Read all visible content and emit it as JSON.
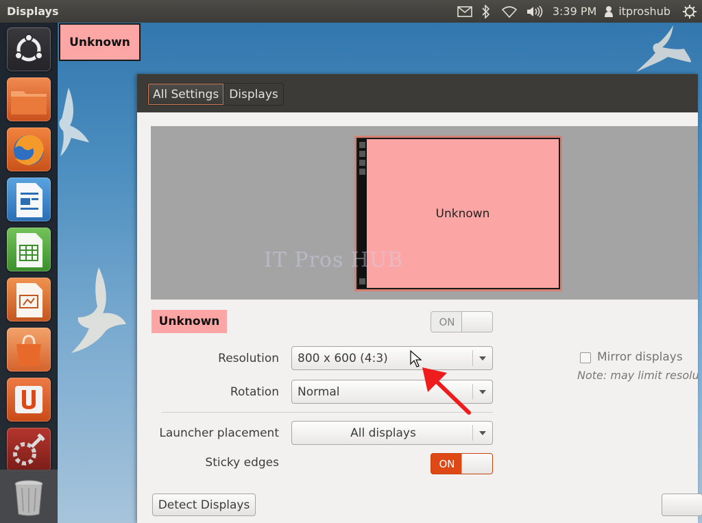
{
  "top_panel": {
    "app_title": "Displays",
    "time": "3:39 PM",
    "user": "itproshub",
    "icons": [
      "mail-icon",
      "bluetooth-icon",
      "wifi-icon",
      "volume-icon",
      "user-icon",
      "power-gear-icon"
    ]
  },
  "launcher": {
    "items": [
      {
        "name": "dash-home",
        "icon": "ubuntu-logo-icon"
      },
      {
        "name": "files",
        "icon": "folder-icon"
      },
      {
        "name": "firefox",
        "icon": "firefox-icon"
      },
      {
        "name": "libreoffice-writer",
        "icon": "writer-icon"
      },
      {
        "name": "libreoffice-calc",
        "icon": "calc-icon"
      },
      {
        "name": "libreoffice-impress",
        "icon": "impress-icon"
      },
      {
        "name": "software-center",
        "icon": "shopping-bag-icon"
      },
      {
        "name": "ubuntu-one",
        "icon": "ubuntu-one-icon"
      },
      {
        "name": "system-settings",
        "icon": "settings-wrench-icon"
      },
      {
        "name": "trash",
        "icon": "trash-icon"
      }
    ]
  },
  "monitor_overlay_label": "Unknown",
  "window": {
    "breadcrumbs": [
      "All Settings",
      "Displays"
    ],
    "arrangement": {
      "monitor_label": "Unknown",
      "watermark": "IT Pros HUB"
    },
    "display_name": "Unknown",
    "display_toggle": "ON",
    "mirror": {
      "label": "Mirror displays",
      "note": "Note: may limit resolution",
      "checked": false
    },
    "resolution": {
      "label": "Resolution",
      "value": "800 x 600 (4:3)"
    },
    "rotation": {
      "label": "Rotation",
      "value": "Normal"
    },
    "launcher_placement": {
      "label": "Launcher placement",
      "value": "All displays"
    },
    "sticky_edges": {
      "label": "Sticky edges",
      "value": "ON"
    },
    "detect_button": "Detect Displays"
  },
  "colors": {
    "accent_orange": "#dd4814",
    "monitor_pink": "#fca5a5",
    "panel_dark": "#3c3b37"
  }
}
